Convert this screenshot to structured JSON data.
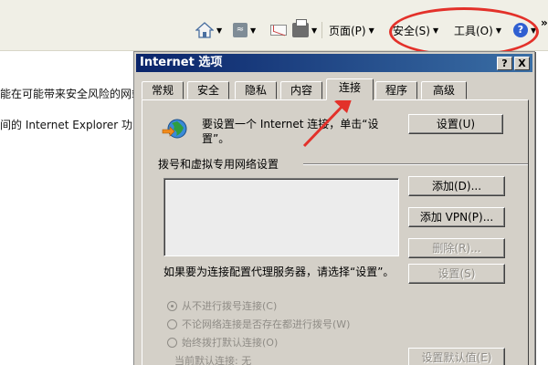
{
  "toolbar": {
    "home_icon": "home-icon",
    "feeds_icon": "rss-feed-icon",
    "mail_icon": "mail-icon",
    "print_icon": "print-icon",
    "help_icon": "help-icon",
    "page_label": "页面(P)",
    "safety_label": "安全(S)",
    "tools_label": "工具(O)",
    "help_glyph": "?",
    "overflow_glyph": "»"
  },
  "background_page": {
    "line1": "能在可能带来安全风险的网站",
    "line2": "间的 Internet Explorer 功"
  },
  "dialog": {
    "title": "Internet 选项",
    "help_btn": "?",
    "close_btn": "X",
    "tabs": [
      {
        "label": "常规"
      },
      {
        "label": "安全"
      },
      {
        "label": "隐私"
      },
      {
        "label": "内容"
      },
      {
        "label": "连接"
      },
      {
        "label": "程序"
      },
      {
        "label": "高级"
      }
    ],
    "active_tab": "连接",
    "setup_text": "要设置一个 Internet 连接，单击“设置”。",
    "setup_button": "设置(U)",
    "dialup_section": "拨号和虚拟专用网络设置",
    "add_button": "添加(D)...",
    "add_vpn_button": "添加 VPN(P)...",
    "remove_button": "删除(R)...",
    "proxy_text": "如果要为连接配置代理服务器，请选择“设置”。",
    "settings_button": "设置(S)",
    "radio_options": [
      {
        "label": "从不进行拨号连接(C)",
        "checked": true
      },
      {
        "label": "不论网络连接是否存在都进行拨号(W)",
        "checked": false
      },
      {
        "label": "始终拨打默认连接(O)",
        "checked": false
      }
    ],
    "current_default": "当前默认连接:  无",
    "set_default_button": "设置默认值(E)"
  },
  "colors": {
    "annotation_red": "#e3312a",
    "title_bar_start": "#0a246a",
    "title_bar_end": "#3a6ea5",
    "dialog_face": "#d4d0c8"
  }
}
